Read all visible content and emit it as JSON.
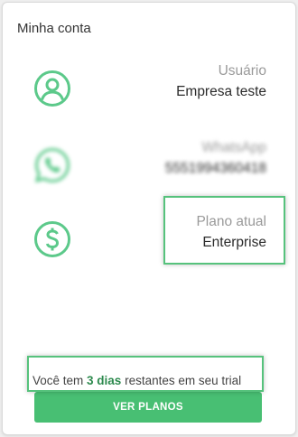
{
  "card": {
    "title": "Minha conta"
  },
  "user": {
    "label": "Usuário",
    "value": "Empresa teste",
    "icon": "user-circle-icon"
  },
  "whatsapp": {
    "label": "WhatsApp",
    "value": "5551994360418",
    "icon": "whatsapp-icon"
  },
  "plan": {
    "label": "Plano atual",
    "value": "Enterprise",
    "icon": "dollar-circle-icon"
  },
  "trial": {
    "prefix": "Você tem ",
    "days": "3 dias",
    "suffix": " restantes em seu trial"
  },
  "button": {
    "label": "VER PLANOS"
  },
  "colors": {
    "accent": "#48bf73",
    "icon": "#5cc98a",
    "highlight_border": "#56c27c"
  }
}
